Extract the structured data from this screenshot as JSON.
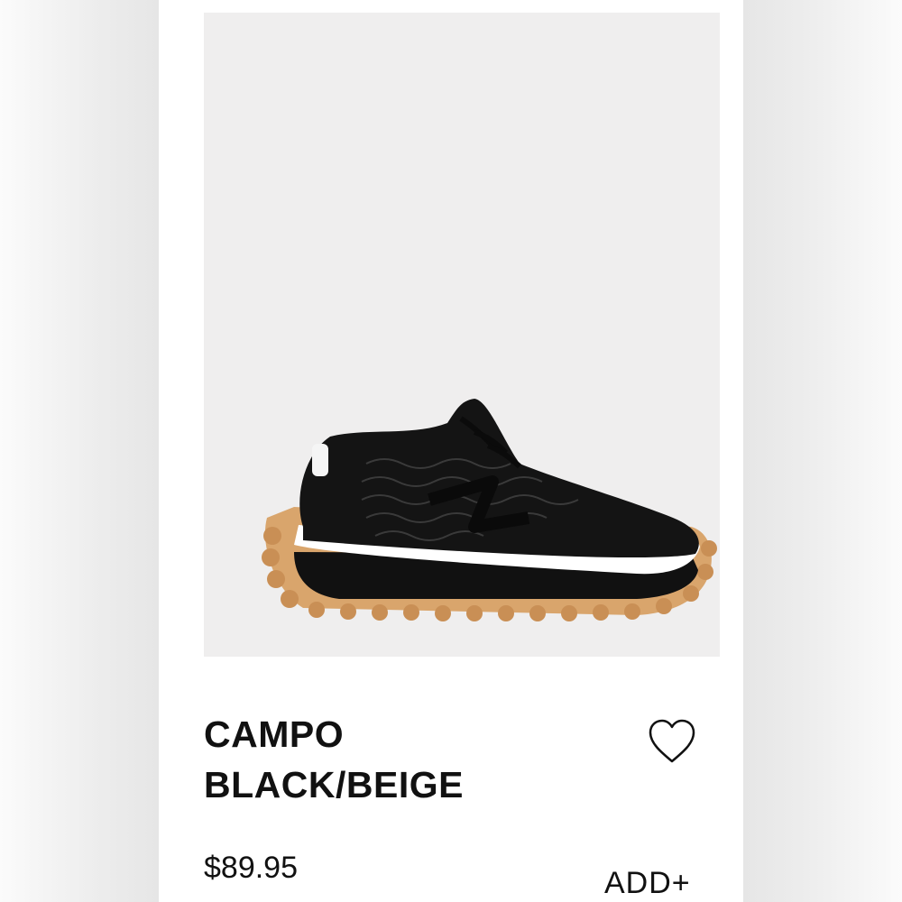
{
  "product": {
    "image_alt": "black sneaker with beige lug sole",
    "title_line1": "CAMPO",
    "title_line2": "BLACK/BEIGE",
    "price": "$89.95",
    "add_label": "ADD+",
    "wishlist_icon": "heart-outline-icon"
  },
  "colors": {
    "image_background": "#efeeee",
    "text": "#111111",
    "sole": "#d9a56c"
  }
}
